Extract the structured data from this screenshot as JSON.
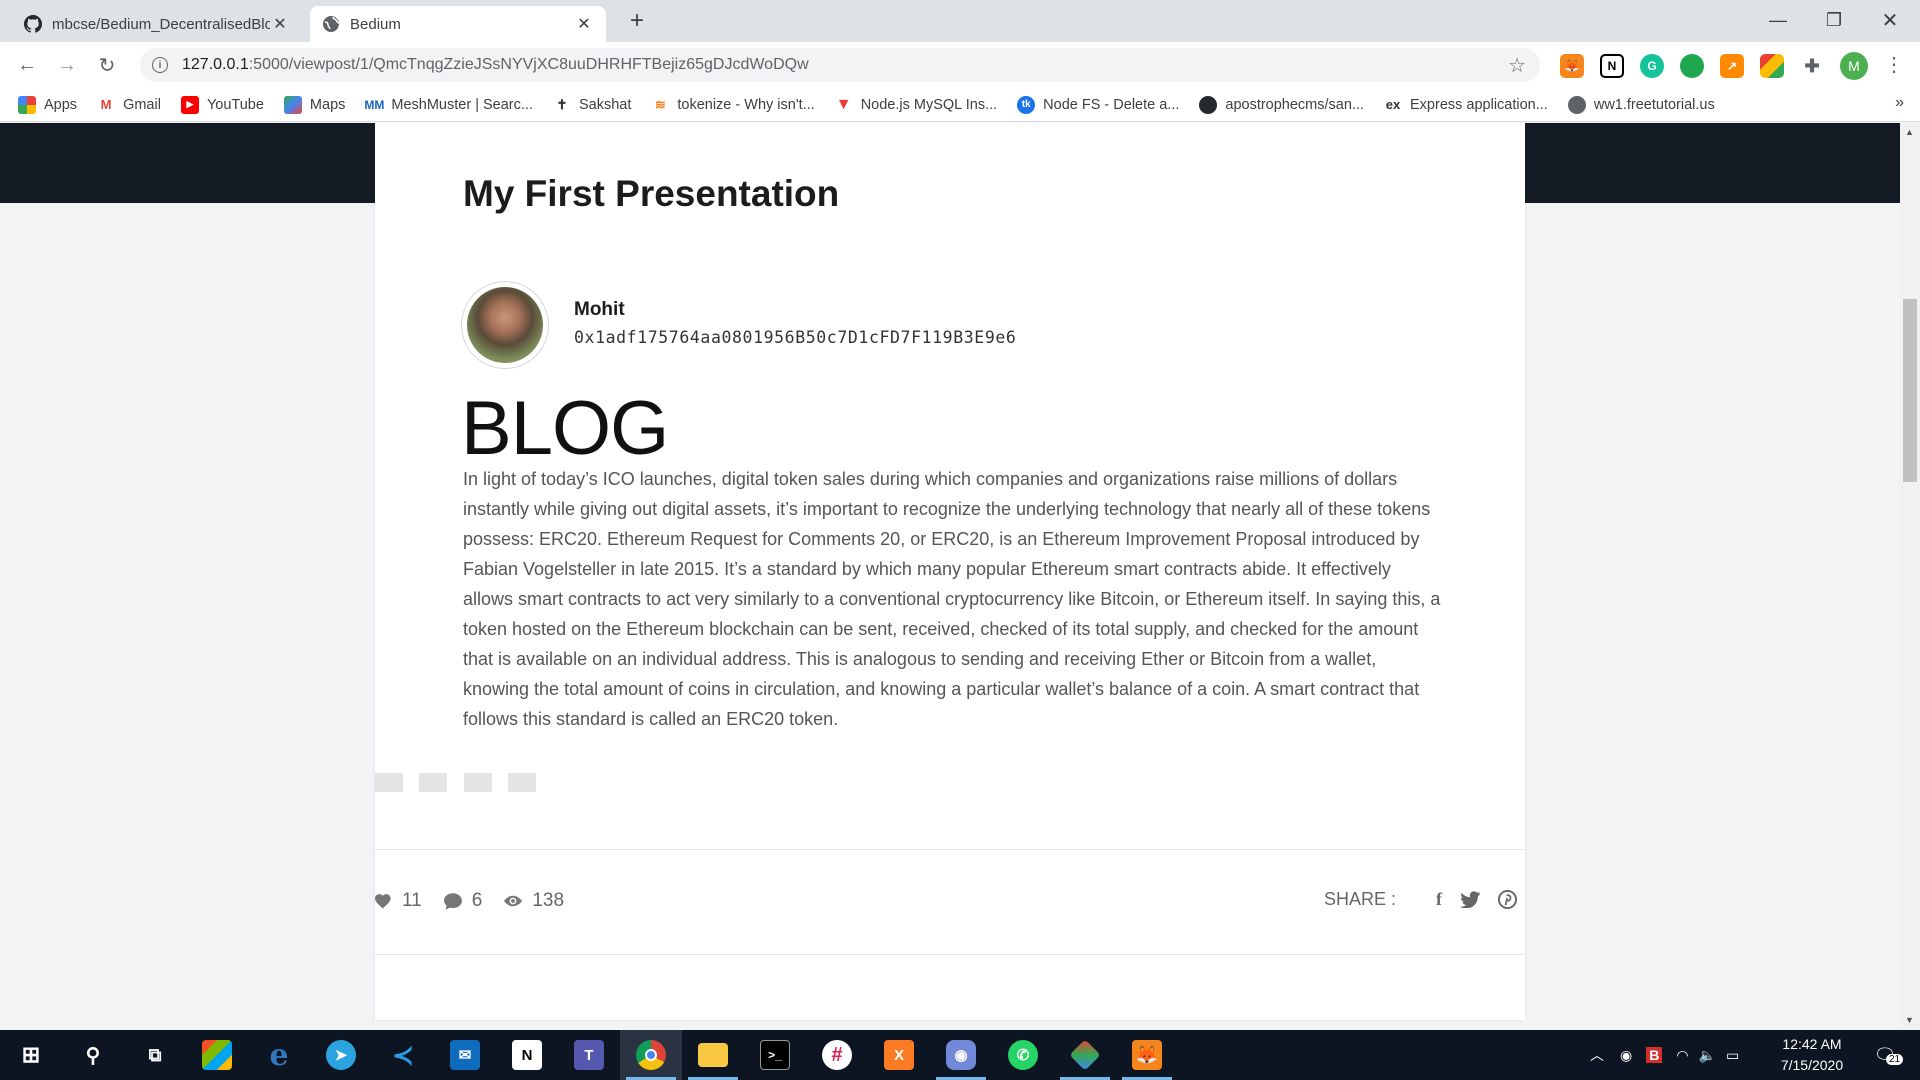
{
  "tabs": [
    {
      "title": "mbcse/Bedium_DecentralisedBlo",
      "icon": "github-icon",
      "active": false
    },
    {
      "title": "Bedium",
      "icon": "globe-icon",
      "active": true
    }
  ],
  "toolbar": {
    "url_host": "127.0.0.1",
    "url_path": ":5000/viewpost/1/QmcTnqgZzieJSsNYVjXC8uuDHRHFTBejiz65gDJcdWoDQw",
    "profile_initial": "M",
    "extensions": [
      "metamask-icon",
      "notion-icon",
      "grammarly-icon",
      "chat-icon",
      "trend-icon",
      "color-icon",
      "puzzle-icon"
    ]
  },
  "bookmarks": [
    {
      "label": "Apps",
      "icon": "apps-grid-icon"
    },
    {
      "label": "Gmail",
      "icon": "gmail-icon"
    },
    {
      "label": "YouTube",
      "icon": "youtube-icon"
    },
    {
      "label": "Maps",
      "icon": "maps-icon"
    },
    {
      "label": "MeshMuster | Searc...",
      "icon": "meshmuster-icon"
    },
    {
      "label": "Sakshat",
      "icon": "sakshat-icon"
    },
    {
      "label": "tokenize - Why isn't...",
      "icon": "stackoverflow-icon"
    },
    {
      "label": "Node.js MySQL Ins...",
      "icon": "w3schools-icon"
    },
    {
      "label": "Node FS - Delete a...",
      "icon": "tutorialkart-icon"
    },
    {
      "label": "apostrophecms/san...",
      "icon": "github-icon"
    },
    {
      "label": "Express application...",
      "icon": "express-icon"
    },
    {
      "label": "ww1.freetutorial.us",
      "icon": "globe-icon"
    }
  ],
  "bookmarks_overflow": "»",
  "post": {
    "title": "My First Presentation",
    "author_name": "Mohit",
    "author_address": "0x1adf175764aa0801956B50c7D1cFD7F119B3E9e6",
    "heading": "BLOG",
    "body": "In light of today’s ICO launches, digital token sales during which companies and organizations raise millions of dollars instantly while giving out digital assets, it’s important to recognize the underlying technology that nearly all of these tokens possess: ERC20. Ethereum Request for Comments 20, or ERC20, is an Ethereum Improvement Proposal introduced by Fabian Vogelsteller in late 2015. It’s a standard by which many popular Ethereum smart contracts abide. It effectively allows smart contracts to act very similarly to a conventional cryptocurrency like Bitcoin, or Ethereum itself. In saying this, a token hosted on the Ethereum blockchain can be sent, received, checked of its total supply, and checked for the amount that is available on an individual address. This is analogous to sending and receiving Ether or Bitcoin from a wallet, knowing the total amount of coins in circulation, and knowing a particular wallet’s balance of a coin. A smart contract that follows this standard is called an ERC20 token."
  },
  "stats": {
    "likes": "11",
    "comments": "6",
    "views": "138"
  },
  "share": {
    "label": "SHARE :",
    "icons": [
      "facebook-icon",
      "twitter-icon",
      "pinterest-icon"
    ]
  },
  "taskbar": {
    "apps": [
      "start-icon",
      "search-icon",
      "task-view-icon",
      "store-icon",
      "edge-icon",
      "telegram-icon",
      "vscode-icon",
      "mail-icon",
      "notion-icon",
      "teams-icon",
      "chrome-icon",
      "file-explorer-icon",
      "terminal-icon",
      "slack-icon",
      "xampp-icon",
      "discord-icon",
      "whatsapp-icon",
      "git-icon",
      "metamask-icon"
    ],
    "time": "12:42 AM",
    "date": "7/15/2020",
    "notification_count": "21"
  },
  "colors": {
    "page_bg": "#f1f3f5",
    "nav_band": "#131a24",
    "taskbar": "#0c1521",
    "text_body": "#555555"
  }
}
